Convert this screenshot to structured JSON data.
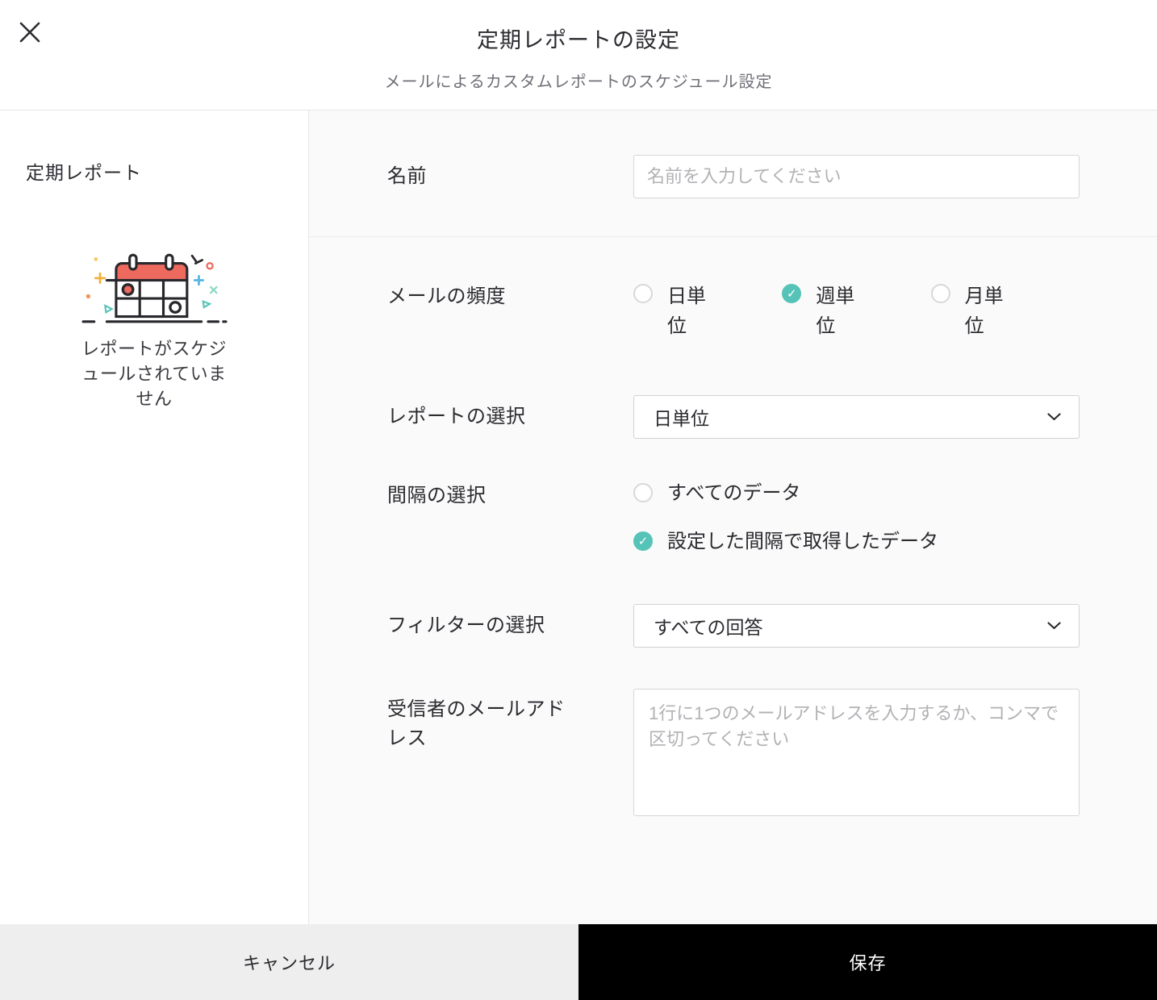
{
  "header": {
    "title": "定期レポートの設定",
    "subtitle": "メールによるカスタムレポートのスケジュール設定",
    "close_icon": "close-x"
  },
  "sidebar": {
    "title": "定期レポート",
    "empty_state": {
      "illustration": "calendar-illustration",
      "message": "レポートがスケジュールされていません"
    }
  },
  "form": {
    "name": {
      "label": "名前",
      "value": "",
      "placeholder": "名前を入力してください"
    },
    "frequency": {
      "label": "メールの頻度",
      "options": [
        {
          "label": "日単位",
          "selected": false
        },
        {
          "label": "週単位",
          "selected": true
        },
        {
          "label": "月単位",
          "selected": false
        }
      ]
    },
    "report": {
      "label": "レポートの選択",
      "value": "日単位"
    },
    "interval": {
      "label": "間隔の選択",
      "options": [
        {
          "label": "すべてのデータ",
          "selected": false
        },
        {
          "label": "設定した間隔で取得したデータ",
          "selected": true
        }
      ]
    },
    "filter": {
      "label": "フィルターの選択",
      "value": "すべての回答"
    },
    "recipients": {
      "label": "受信者のメールアドレス",
      "value": "",
      "placeholder": "1行に1つのメールアドレスを入力するか、コンマで区切ってください"
    }
  },
  "footer": {
    "cancel_label": "キャンセル",
    "save_label": "保存"
  },
  "colors": {
    "accent_teal": "#55c3b7",
    "illustration_red": "#ee6a5f",
    "save_button_bg": "#000000",
    "cancel_button_bg": "#eeeeee",
    "main_panel_bg": "#fafafa",
    "check_glyph": "✓"
  }
}
